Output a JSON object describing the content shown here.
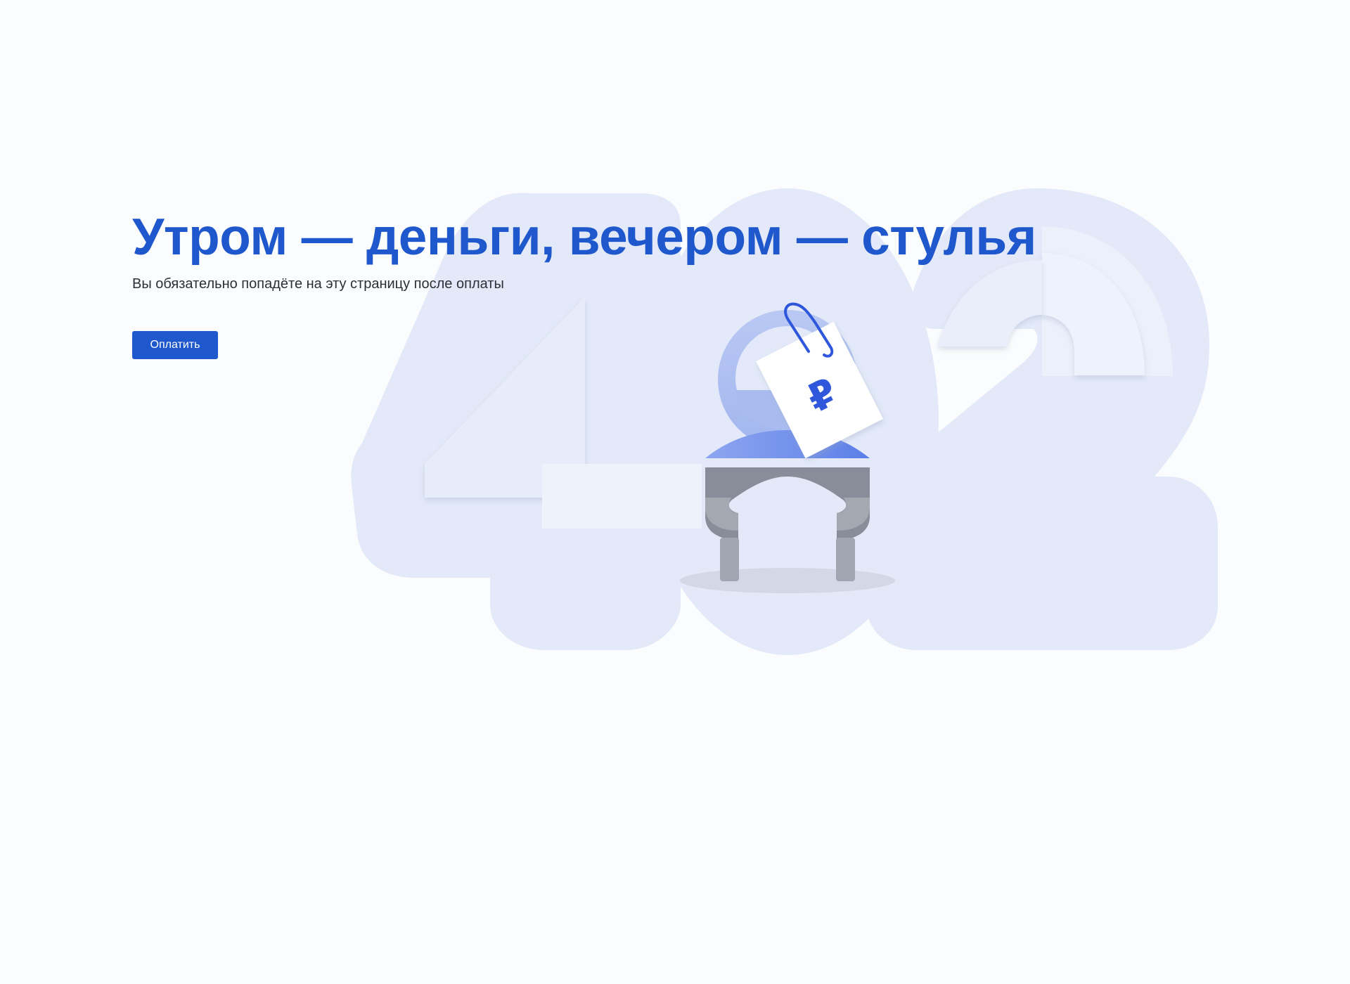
{
  "page": {
    "title": "Утром — деньги, вечером — стулья",
    "subtitle": "Вы обязательно попадёте на эту страницу после оплаты",
    "pay_button_label": "Оплатить"
  },
  "illustration": {
    "background_code": "402",
    "currency_symbol": "₽",
    "icons": [
      "chair-icon",
      "price-tag-icon",
      "paperclip-icon"
    ]
  },
  "colors": {
    "accent": "#1f57cc",
    "background": "#fbfcfd",
    "shape_fill": "#e3e9f8",
    "chair_grey": "#868c97"
  }
}
